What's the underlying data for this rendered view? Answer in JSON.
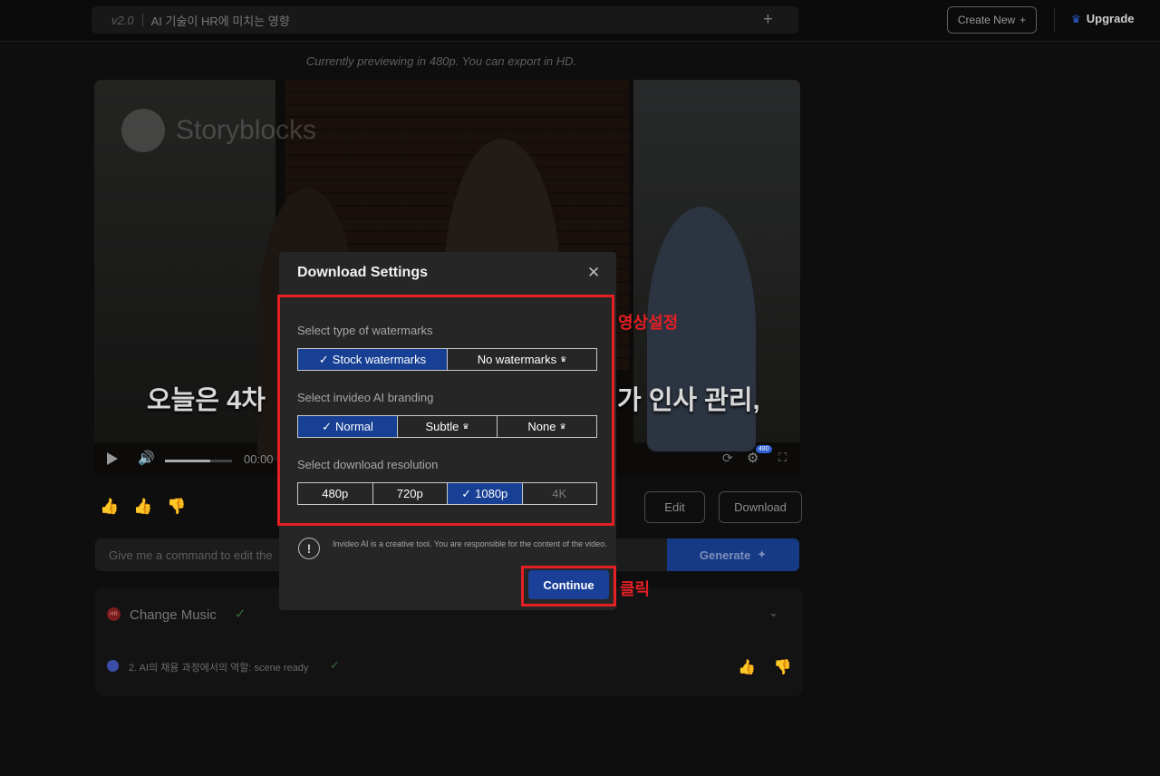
{
  "topbar": {
    "version": "v2.0",
    "project_title": "AI 기술이 HR에 미치는 영향",
    "add_icon": "plus-icon",
    "create_new_label": "Create New",
    "upgrade_label": "Upgrade",
    "upgrade_icon": "crown-icon"
  },
  "preview_note": "Currently previewing in 480p. You can export in HD.",
  "video": {
    "watermark_text": "Storyblocks",
    "subtitle_left": "오늘은 4차 ",
    "subtitle_right": "가 인사 관리,",
    "time": "00:00",
    "quality_badge": "480",
    "volume_level": 0.68
  },
  "actions": {
    "edit_label": "Edit",
    "download_label": "Download"
  },
  "command": {
    "placeholder": "Give me a command to edit the",
    "generate_label": "Generate"
  },
  "panel": {
    "hr_badge": "HR",
    "change_music_label": "Change Music",
    "scene_label": "2. AI의 채용 과정에서의 역할: scene ready"
  },
  "modal": {
    "title": "Download Settings",
    "watermark_label": "Select type of watermarks",
    "watermark_options": [
      "Stock watermarks",
      "No watermarks"
    ],
    "watermark_selected": "Stock watermarks",
    "branding_label": "Select invideo AI branding",
    "branding_options": [
      "Normal",
      "Subtle",
      "None"
    ],
    "branding_selected": "Normal",
    "resolution_label": "Select download resolution",
    "resolution_options": [
      "480p",
      "720p",
      "1080p",
      "4K"
    ],
    "resolution_selected": "1080p",
    "info_text": "Invideo AI is a creative tool. You are responsible for the content of the video.",
    "continue_label": "Continue"
  },
  "annotations": {
    "settings_note": "영상설정",
    "click_note": "클릭",
    "color": "#e51f24"
  },
  "colors": {
    "accent": "#173f93",
    "background": "#0e0e0e",
    "modal": "#262626"
  }
}
